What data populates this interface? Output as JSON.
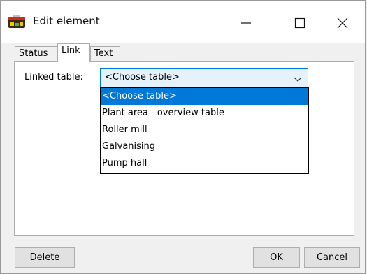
{
  "window": {
    "title": "Edit element",
    "icon": "app-logo-icon",
    "controls": [
      "minimize-icon",
      "maximize-icon",
      "close-icon"
    ]
  },
  "tabs": [
    {
      "label": "Status",
      "active": false
    },
    {
      "label": "Link",
      "active": true
    },
    {
      "label": "Text",
      "active": false
    }
  ],
  "link_tab": {
    "field_label": "Linked table:",
    "selected_value": "<Choose table>",
    "options": [
      "<Choose table>",
      "Plant area - overview table",
      "Roller mill",
      "Galvanising",
      "Pump hall"
    ],
    "highlighted_option": "<Choose table>"
  },
  "buttons": {
    "delete": "Delete",
    "ok": "OK",
    "cancel": "Cancel"
  },
  "colors": {
    "selection": "#0078d7",
    "select_bg": "#e5f1fb",
    "dialog_bg": "#f0f0f0"
  }
}
